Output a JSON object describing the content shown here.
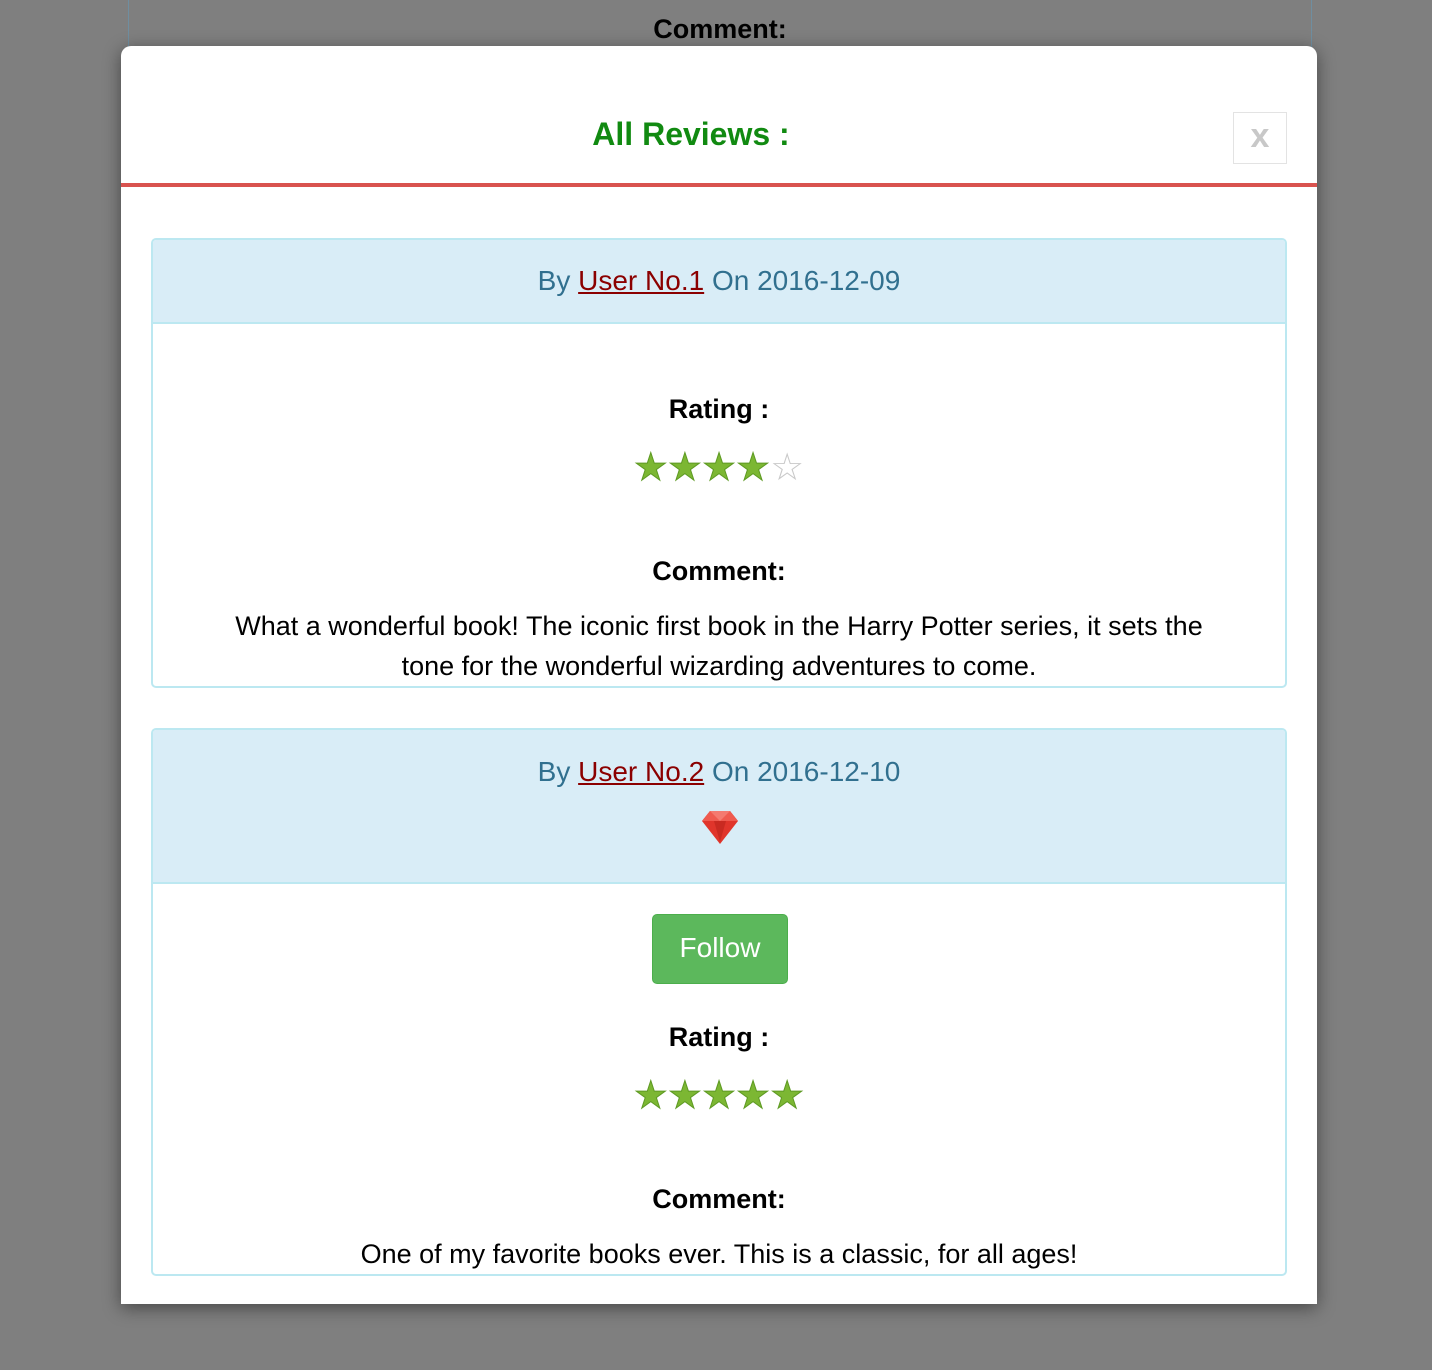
{
  "background": {
    "comment_label": "Comment:"
  },
  "modal": {
    "title": "All Reviews :",
    "close_label": "x"
  },
  "reviews": [
    {
      "by_prefix": "By",
      "user": "User No.1",
      "on_prefix": "On",
      "date": "2016-12-09",
      "rating_label": "Rating :",
      "rating": 4,
      "rating_max": 5,
      "comment_label": "Comment:",
      "comment": "What a wonderful book! The iconic first book in the Harry Potter series, it sets the tone for the wonderful wizarding adventures to come."
    },
    {
      "by_prefix": "By",
      "user": "User No.2",
      "on_prefix": "On",
      "date": "2016-12-10",
      "badge_icon": "ruby-gem-icon",
      "follow_label": "Follow",
      "rating_label": "Rating :",
      "rating": 5,
      "rating_max": 5,
      "comment_label": "Comment:",
      "comment": "One of my favorite books ever. This is a classic, for all ages!"
    }
  ],
  "colors": {
    "title": "#118a11",
    "header_rule": "#d9534f",
    "panel_heading_bg": "#d9edf7",
    "panel_heading_text": "#31708f",
    "user_link": "#8b0000",
    "star_filled": "#7cb733",
    "star_empty": "#c9c9c9",
    "follow_button": "#5cb85c"
  }
}
